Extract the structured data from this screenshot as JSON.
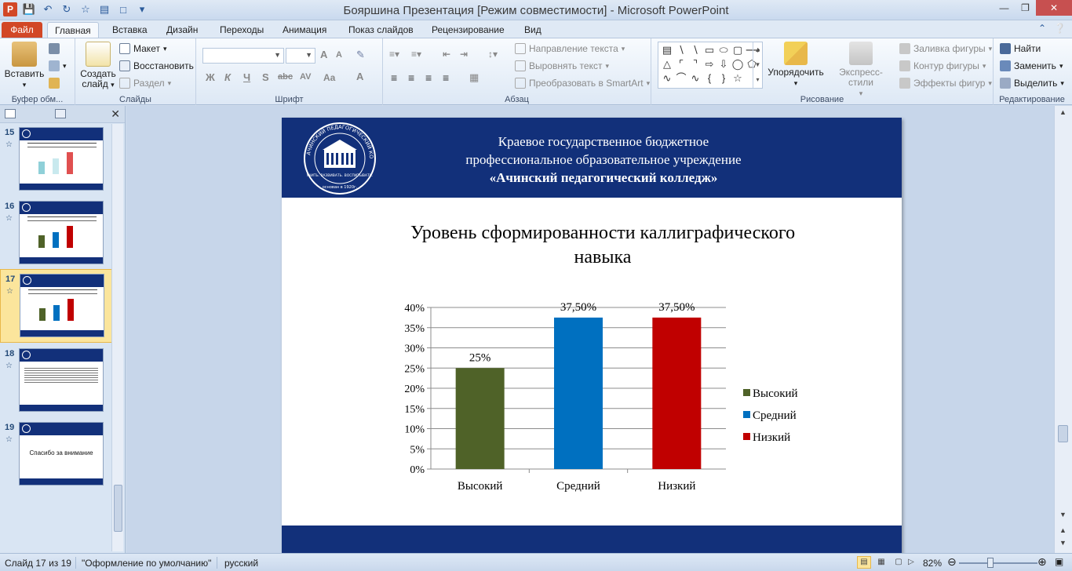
{
  "window": {
    "title": "Бояршина Презентация [Режим совместимости]  -  Microsoft PowerPoint",
    "app_icon": "P"
  },
  "tabs": {
    "file": "Файл",
    "items": [
      "Главная",
      "Вставка",
      "Дизайн",
      "Переходы",
      "Анимация",
      "Показ слайдов",
      "Рецензирование",
      "Вид"
    ]
  },
  "ribbon": {
    "clipboard": {
      "paste": "Вставить",
      "label": "Буфер обм..."
    },
    "slides": {
      "create": "Создать",
      "create2": "слайд",
      "layout": "Макет",
      "restore": "Восстановить",
      "section": "Раздел",
      "label": "Слайды"
    },
    "font": {
      "label": "Шрифт",
      "bold": "Ж",
      "italic": "К",
      "underline": "Ч",
      "shadow": "S",
      "strike": "abc",
      "spacing": "AV",
      "case": "Aa",
      "color": "A",
      "grow": "A",
      "shrink": "A"
    },
    "paragraph": {
      "text_direction": "Направление текста",
      "align_text": "Выровнять текст",
      "smartart": "Преобразовать в SmartArt",
      "label": "Абзац"
    },
    "drawing": {
      "arrange": "Упорядочить",
      "quick_styles": "Экспресс-стили",
      "fill": "Заливка фигуры",
      "outline": "Контур фигуры",
      "effects": "Эффекты фигур",
      "label": "Рисование"
    },
    "editing": {
      "find": "Найти",
      "replace": "Заменить",
      "select": "Выделить",
      "label": "Редактирование"
    }
  },
  "thumbnails": [
    {
      "num": "15",
      "kind": "chart",
      "bars": [
        "#8fd0d8",
        "#c9e9ee",
        "#e05050"
      ]
    },
    {
      "num": "16",
      "kind": "chart",
      "bars": [
        "#4f6228",
        "#0070c0",
        "#c00000"
      ]
    },
    {
      "num": "17",
      "kind": "chart",
      "bars": [
        "#4f6228",
        "#0070c0",
        "#c00000"
      ]
    },
    {
      "num": "18",
      "kind": "text"
    },
    {
      "num": "19",
      "kind": "thanks",
      "text": "Спасибо  за внимание"
    }
  ],
  "slide": {
    "header_line1": "Краевое государственное бюджетное",
    "header_line2": "профессиональное образовательное учреждение",
    "header_line3": "«Ачинский педагогический колледж»",
    "logo_text_top": "АЧИНСКИЙ ПЕДАГОГИЧЕСКИЙ КОЛЛЕДЖ",
    "logo_text_bottom": "УЧИТЬ. РАЗВИВАТЬ. ВОСПИТЫВАТЬ.",
    "logo_year": "основан в 1920г."
  },
  "chart_data": {
    "type": "bar",
    "title": "Уровень сформированности каллиграфического навыка",
    "title_lines": [
      "Уровень сформированности каллиграфического",
      "навыка"
    ],
    "categories": [
      "Высокий",
      "Средний",
      "Низкий"
    ],
    "values": [
      25,
      37.5,
      37.5
    ],
    "data_labels": [
      "25%",
      "37,50%",
      "37,50%"
    ],
    "colors": [
      "#4f6228",
      "#0070c0",
      "#c00000"
    ],
    "ylim": [
      0,
      40
    ],
    "yticks": [
      "0%",
      "5%",
      "10%",
      "15%",
      "20%",
      "25%",
      "30%",
      "35%",
      "40%"
    ],
    "legend": [
      "Высокий",
      "Средний",
      "Низкий"
    ],
    "legend_position": "right",
    "grid": true
  },
  "status": {
    "slide_info": "Слайд 17 из 19",
    "theme": "\"Оформление по умолчанию\"",
    "language": "русский",
    "zoom": "82%"
  }
}
